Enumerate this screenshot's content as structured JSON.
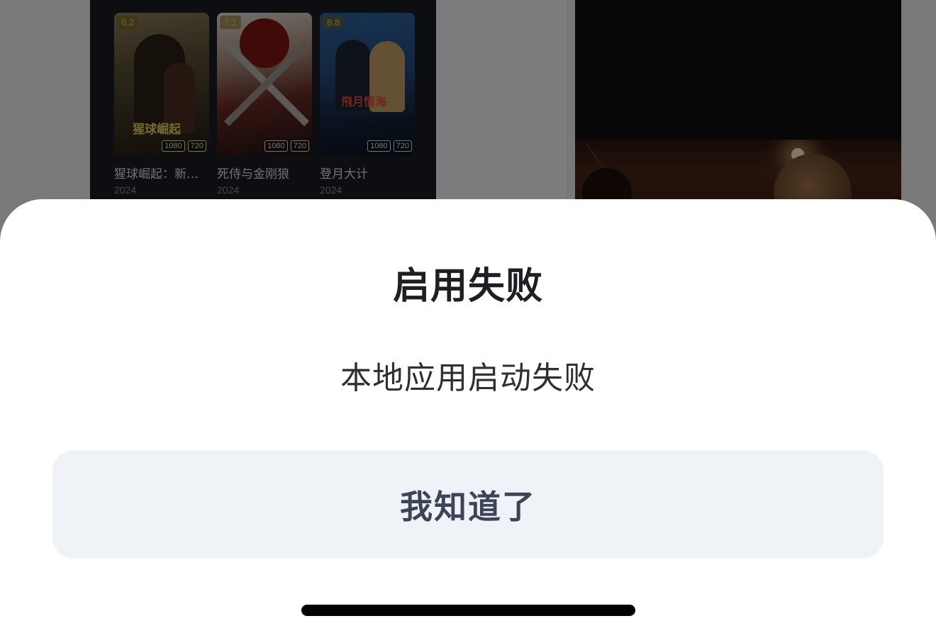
{
  "background": {
    "movies": [
      {
        "title": "猩球崛起：新…",
        "year": "2024",
        "rating": "6.2",
        "poster_text": "猩球崛起",
        "qualities": [
          "1080",
          "720"
        ]
      },
      {
        "title": "死侍与金刚狼",
        "year": "2024",
        "rating": "7.1",
        "poster_text": "",
        "qualities": [
          "1080",
          "720"
        ]
      },
      {
        "title": "登月大计",
        "year": "2024",
        "rating": "8.8",
        "poster_text": "飛月情海",
        "qualities": [
          "1080",
          "720"
        ]
      }
    ]
  },
  "dialog": {
    "title": "启用失败",
    "message": "本地应用启动失败",
    "confirm_label": "我知道了"
  },
  "colors": {
    "sheet_background": "#ffffff",
    "button_background": "#eff2f7",
    "button_text": "#3d4456",
    "title_text": "#1e1f22",
    "rating_text": "#f2c14b",
    "overlay": "rgba(0,0,0,0.5)"
  }
}
